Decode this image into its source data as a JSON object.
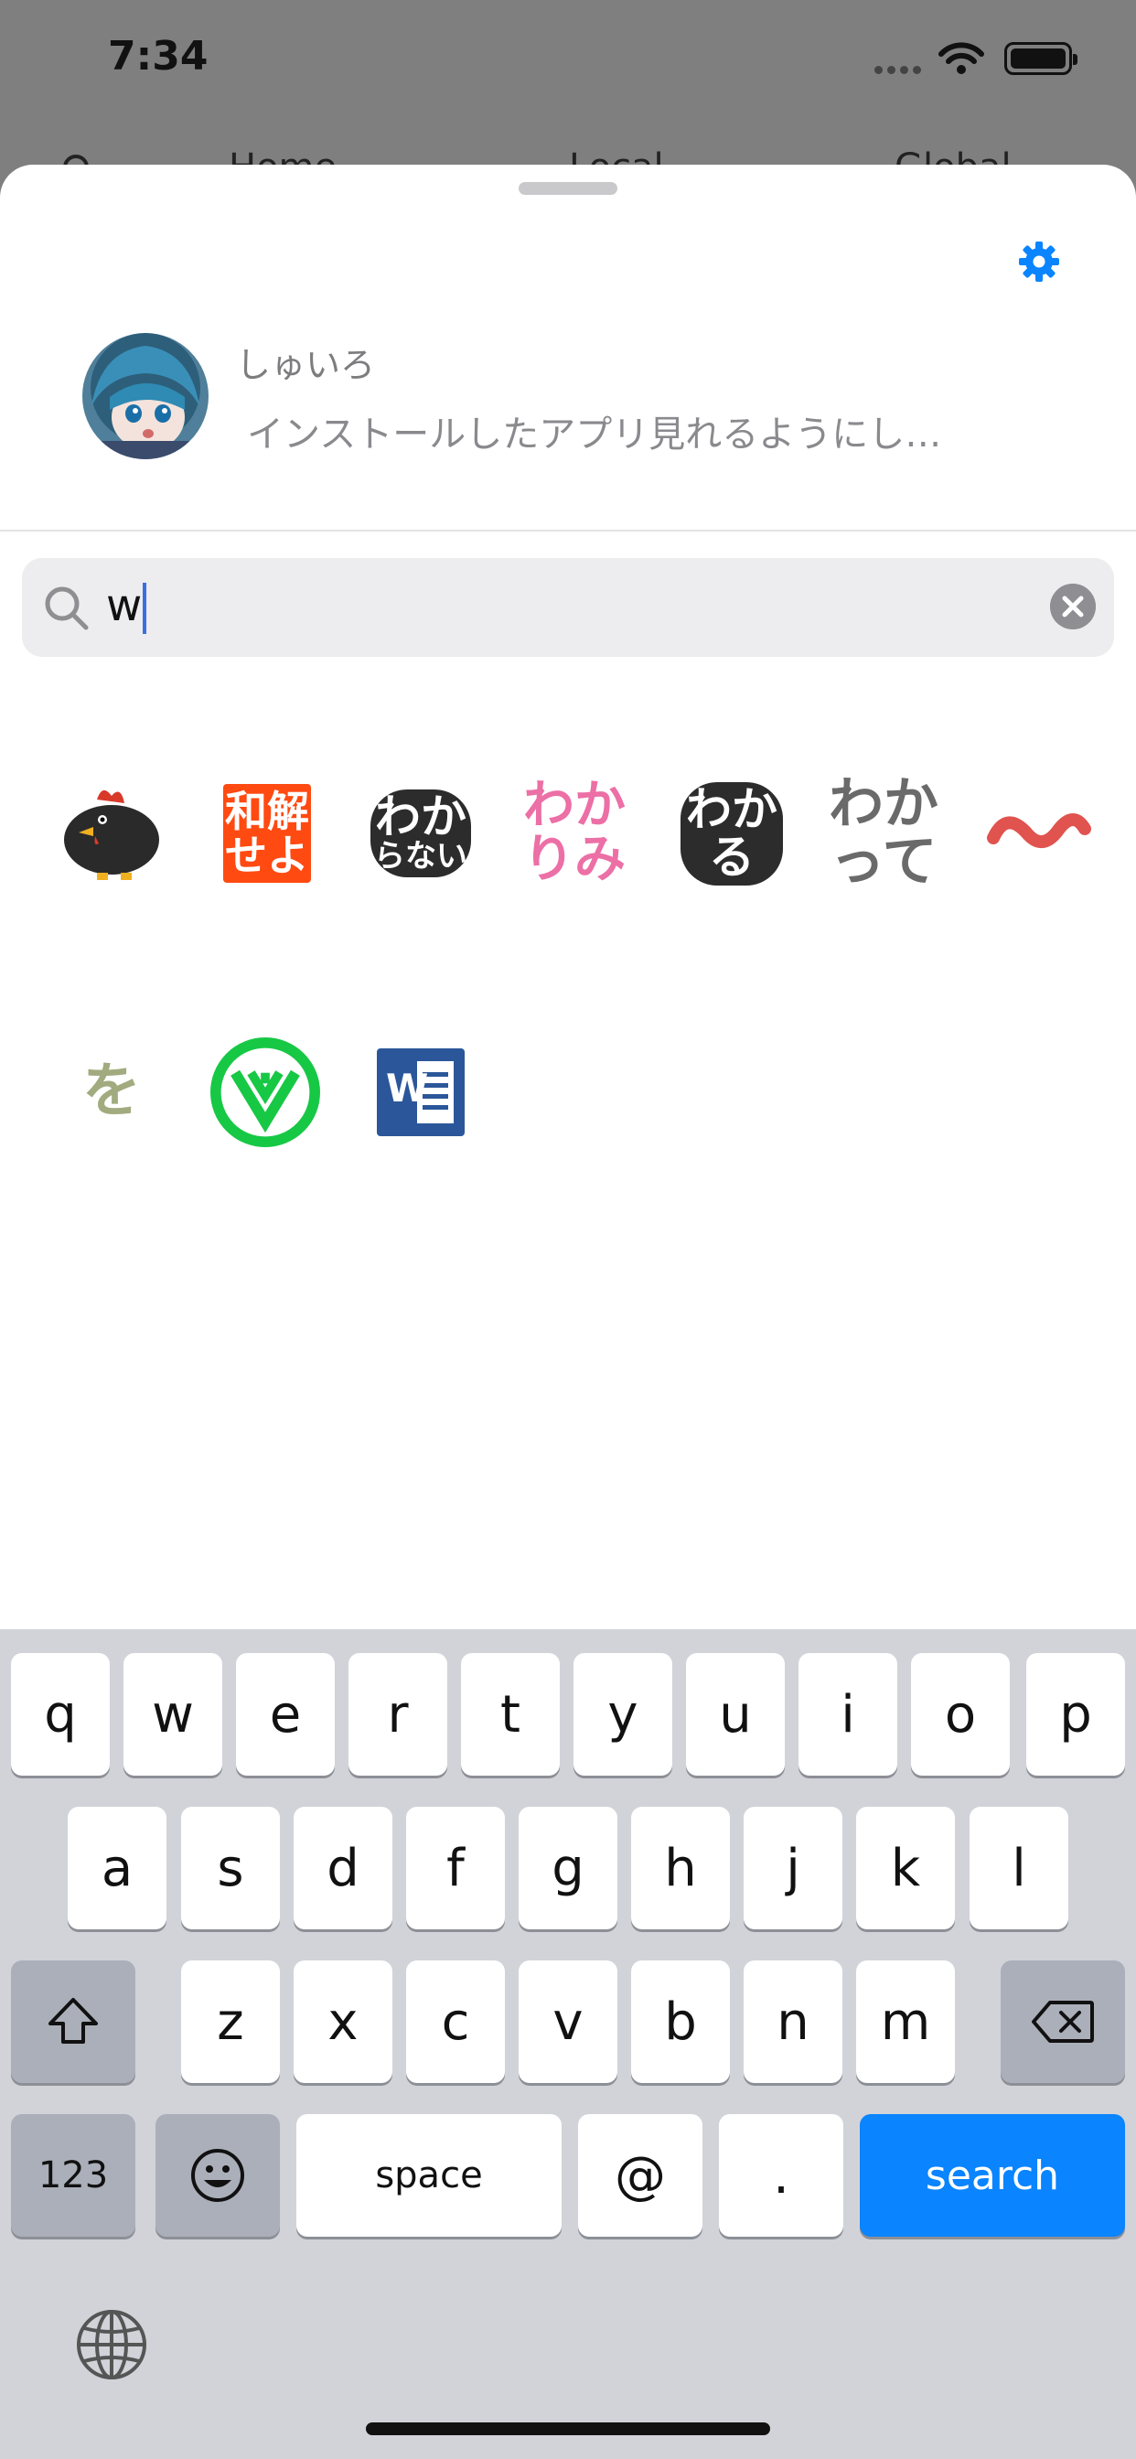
{
  "status_bar": {
    "time": "7:34"
  },
  "background_tabs": {
    "home": "Home",
    "local": "Local",
    "global": "Global"
  },
  "composer": {
    "username": "しゅいろ",
    "message": "インストールしたアプリ見れるようにし…"
  },
  "search": {
    "query": "w"
  },
  "emoji_results": [
    {
      "name": "chicken-emoji",
      "kind": "image"
    },
    {
      "name": "wakai-seyo-emoji",
      "text_line1": "和解",
      "text_line2": "せよ"
    },
    {
      "name": "wakaranai-emoji",
      "text_line1": "わか",
      "text_line2": "らない"
    },
    {
      "name": "wakarimi-emoji",
      "text_line1": "わか",
      "text_line2": "りみ"
    },
    {
      "name": "wakaru-emoji",
      "text_line1": "わか",
      "text_line2": "る"
    },
    {
      "name": "wakatte-emoji",
      "text_line1": "わか",
      "text_line2": "って"
    },
    {
      "name": "wave-emoji",
      "kind": "image"
    },
    {
      "name": "wo-emoji",
      "text_line1": "を"
    },
    {
      "name": "wealthsimple-emoji",
      "kind": "image"
    },
    {
      "name": "word-emoji",
      "text_line1": "W"
    }
  ],
  "keyboard": {
    "row1": [
      "q",
      "w",
      "e",
      "r",
      "t",
      "y",
      "u",
      "i",
      "o",
      "p"
    ],
    "row2": [
      "a",
      "s",
      "d",
      "f",
      "g",
      "h",
      "j",
      "k",
      "l"
    ],
    "row3": [
      "z",
      "x",
      "c",
      "v",
      "b",
      "n",
      "m"
    ],
    "numbers_label": "123",
    "space_label": "space",
    "at_label": "@",
    "period_label": ".",
    "search_label": "search"
  },
  "colors": {
    "accent": "#0a84ff",
    "sheet": "#ffffff",
    "keyboard": "#d1d3d9"
  }
}
